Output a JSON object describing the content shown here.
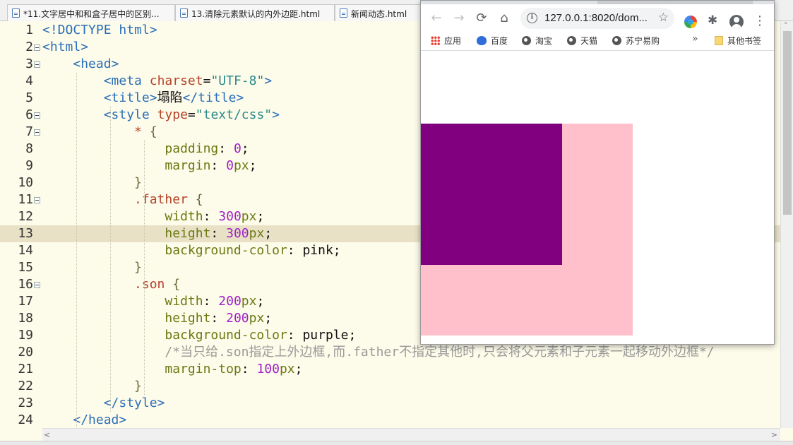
{
  "editor_tabs": [
    {
      "label": "*11.文字居中和和盒子居中的区别..."
    },
    {
      "label": "13.清除元素默认的内外边距.html"
    },
    {
      "label": "新闻动态.html"
    }
  ],
  "code_lines": [
    {
      "n": "1",
      "tokens": [
        [
          "t-tag",
          "<!DOCTYPE html>"
        ]
      ]
    },
    {
      "n": "2",
      "tokens": [
        [
          "t-tag",
          "<html>"
        ]
      ]
    },
    {
      "n": "3",
      "tokens": [
        [
          "t-plain",
          "    "
        ],
        [
          "t-tag",
          "<head>"
        ]
      ]
    },
    {
      "n": "4",
      "tokens": [
        [
          "t-plain",
          "        "
        ],
        [
          "t-tag",
          "<meta "
        ],
        [
          "t-attr",
          "charset"
        ],
        [
          "t-plain",
          "="
        ],
        [
          "t-str",
          "\"UTF-8\""
        ],
        [
          "t-tag",
          ">"
        ]
      ]
    },
    {
      "n": "5",
      "tokens": [
        [
          "t-plain",
          "        "
        ],
        [
          "t-tag",
          "<title>"
        ],
        [
          "t-plain",
          "塌陷"
        ],
        [
          "t-tag",
          "</title>"
        ]
      ]
    },
    {
      "n": "6",
      "tokens": [
        [
          "t-plain",
          "        "
        ],
        [
          "t-tag",
          "<style "
        ],
        [
          "t-attr",
          "type"
        ],
        [
          "t-plain",
          "="
        ],
        [
          "t-str",
          "\"text/css\""
        ],
        [
          "t-tag",
          ">"
        ]
      ]
    },
    {
      "n": "7",
      "tokens": [
        [
          "t-plain",
          "            "
        ],
        [
          "t-sel",
          "* "
        ],
        [
          "t-brace",
          "{"
        ]
      ]
    },
    {
      "n": "8",
      "tokens": [
        [
          "t-plain",
          "                "
        ],
        [
          "t-prop",
          "padding"
        ],
        [
          "t-plain",
          ": "
        ],
        [
          "t-num",
          "0"
        ],
        [
          "t-plain",
          ";"
        ]
      ]
    },
    {
      "n": "9",
      "tokens": [
        [
          "t-plain",
          "                "
        ],
        [
          "t-prop",
          "margin"
        ],
        [
          "t-plain",
          ": "
        ],
        [
          "t-num",
          "0"
        ],
        [
          "t-prop",
          "px"
        ],
        [
          "t-plain",
          ";"
        ]
      ]
    },
    {
      "n": "10",
      "tokens": [
        [
          "t-plain",
          "            "
        ],
        [
          "t-brace",
          "}"
        ]
      ]
    },
    {
      "n": "11",
      "tokens": [
        [
          "t-plain",
          "            "
        ],
        [
          "t-sel",
          ".father "
        ],
        [
          "t-brace",
          "{"
        ]
      ]
    },
    {
      "n": "12",
      "tokens": [
        [
          "t-plain",
          "                "
        ],
        [
          "t-prop",
          "width"
        ],
        [
          "t-plain",
          ": "
        ],
        [
          "t-num",
          "300"
        ],
        [
          "t-prop",
          "px"
        ],
        [
          "t-plain",
          ";"
        ]
      ]
    },
    {
      "n": "13",
      "tokens": [
        [
          "t-plain",
          "                "
        ],
        [
          "t-prop",
          "height"
        ],
        [
          "t-plain",
          ": "
        ],
        [
          "t-num",
          "300"
        ],
        [
          "t-prop",
          "px"
        ],
        [
          "t-plain",
          ";"
        ]
      ]
    },
    {
      "n": "14",
      "tokens": [
        [
          "t-plain",
          "                "
        ],
        [
          "t-prop",
          "background-color"
        ],
        [
          "t-plain",
          ": pink;"
        ]
      ]
    },
    {
      "n": "15",
      "tokens": [
        [
          "t-plain",
          "            "
        ],
        [
          "t-brace",
          "}"
        ]
      ]
    },
    {
      "n": "16",
      "tokens": [
        [
          "t-plain",
          "            "
        ],
        [
          "t-sel",
          ".son "
        ],
        [
          "t-brace",
          "{"
        ]
      ]
    },
    {
      "n": "17",
      "tokens": [
        [
          "t-plain",
          "                "
        ],
        [
          "t-prop",
          "width"
        ],
        [
          "t-plain",
          ": "
        ],
        [
          "t-num",
          "200"
        ],
        [
          "t-prop",
          "px"
        ],
        [
          "t-plain",
          ";"
        ]
      ]
    },
    {
      "n": "18",
      "tokens": [
        [
          "t-plain",
          "                "
        ],
        [
          "t-prop",
          "height"
        ],
        [
          "t-plain",
          ": "
        ],
        [
          "t-num",
          "200"
        ],
        [
          "t-prop",
          "px"
        ],
        [
          "t-plain",
          ";"
        ]
      ]
    },
    {
      "n": "19",
      "tokens": [
        [
          "t-plain",
          "                "
        ],
        [
          "t-prop",
          "background-color"
        ],
        [
          "t-plain",
          ": purple;"
        ]
      ]
    },
    {
      "n": "20",
      "tokens": [
        [
          "t-plain",
          "                "
        ],
        [
          "t-com",
          "/*当只给.son指定上外边框,而.father不指定其他时,只会将父元素和子元素一起移动外边框*/"
        ]
      ]
    },
    {
      "n": "21",
      "tokens": [
        [
          "t-plain",
          "                "
        ],
        [
          "t-prop",
          "margin-top"
        ],
        [
          "t-plain",
          ": "
        ],
        [
          "t-num",
          "100"
        ],
        [
          "t-prop",
          "px"
        ],
        [
          "t-plain",
          ";"
        ]
      ]
    },
    {
      "n": "22",
      "tokens": [
        [
          "t-plain",
          "            "
        ],
        [
          "t-brace",
          "}"
        ]
      ]
    },
    {
      "n": "23",
      "tokens": [
        [
          "t-plain",
          "        "
        ],
        [
          "t-tag",
          "</style>"
        ]
      ]
    },
    {
      "n": "24",
      "tokens": [
        [
          "t-plain",
          "    "
        ],
        [
          "t-tag",
          "</head>"
        ]
      ]
    }
  ],
  "fold_lines": [
    "2",
    "3",
    "6",
    "7",
    "11",
    "16"
  ],
  "highlighted_line": "13",
  "browser": {
    "back_icon": "←",
    "forward_icon": "→",
    "reload_icon": "⟳",
    "home_icon": "⌂",
    "info_icon": "i",
    "url": "127.0.0.1:8020/dom...",
    "star_icon": "☆",
    "puzzle_icon": "✱",
    "menu_icon": "⋮",
    "more_bookmarks_icon": "»",
    "bookmarks": [
      {
        "label": "应用",
        "icon": "apps-grid-icon"
      },
      {
        "label": "百度",
        "icon": "baidu-paw-icon"
      },
      {
        "label": "淘宝",
        "icon": "globe-icon"
      },
      {
        "label": "天猫",
        "icon": "globe-icon"
      },
      {
        "label": "苏宁易购",
        "icon": "globe-icon"
      }
    ],
    "other_bookmarks": "其他书签"
  },
  "colors": {
    "father": "pink",
    "son": "purple",
    "editor_bg": "#fdfbe9",
    "line_highlight": "#e9e1c6"
  }
}
